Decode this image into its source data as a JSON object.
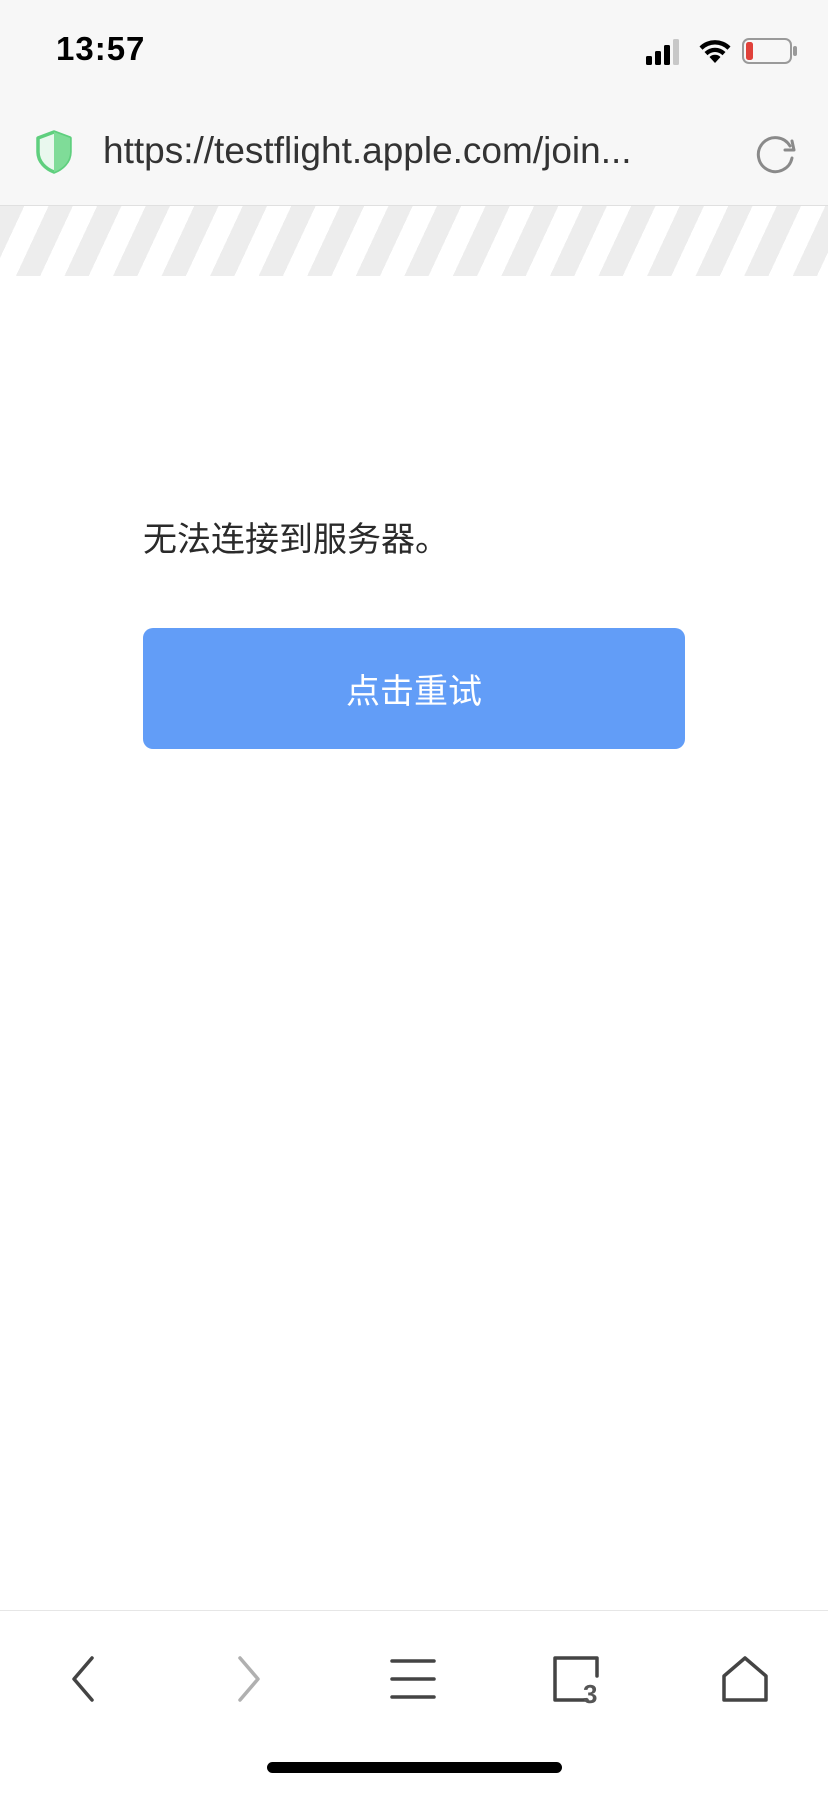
{
  "status_bar": {
    "time": "13:57",
    "signal_icon": "cellular-signal-icon",
    "wifi_icon": "wifi-icon",
    "battery_icon": "battery-low-icon",
    "battery_color": "#e0413a"
  },
  "url_bar": {
    "security_icon": "shield-icon",
    "url": "https://testflight.apple.com/join...",
    "reload_icon": "reload-icon"
  },
  "content": {
    "error_message": "无法连接到服务器。",
    "retry_button_label": "点击重试"
  },
  "toolbar": {
    "back_icon": "chevron-left-icon",
    "forward_icon": "chevron-right-icon",
    "menu_icon": "menu-icon",
    "tabs_icon": "tabs-icon",
    "tabs_count": "3",
    "home_icon": "home-icon"
  },
  "colors": {
    "accent": "#629df7",
    "shield": "#5fcf7e"
  }
}
